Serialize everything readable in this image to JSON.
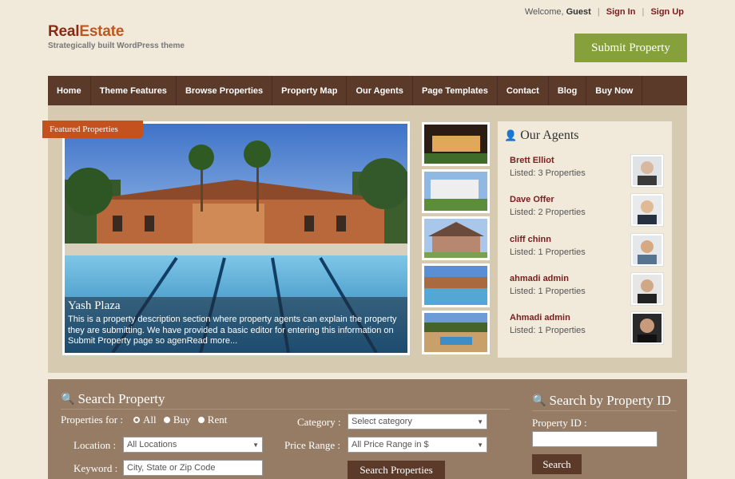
{
  "header": {
    "welcome_prefix": "Welcome,",
    "guest": "Guest",
    "sign_in": "Sign In",
    "sign_up": "Sign Up",
    "logo_part1": "Real",
    "logo_part2": "Estate",
    "tagline": "Strategically built WordPress theme",
    "submit_property": "Submit Property"
  },
  "nav": [
    "Home",
    "Theme Features",
    "Browse Properties",
    "Property Map",
    "Our Agents",
    "Page Templates",
    "Contact",
    "Blog",
    "Buy Now"
  ],
  "slider": {
    "badge": "Featured Properties",
    "title": "Yash Plaza",
    "description": "This is a property description section where property agents can explain the property they are submitting. We have provided a basic editor for entering this information on Submit Property page so agenRead more..."
  },
  "agents": {
    "title": "Our Agents",
    "list": [
      {
        "name": "Brett Elliot",
        "listed": "Listed: 3 Properties"
      },
      {
        "name": "Dave Offer",
        "listed": "Listed: 2 Properties"
      },
      {
        "name": "cliff chinn",
        "listed": "Listed: 1 Properties"
      },
      {
        "name": "ahmadi admin",
        "listed": "Listed: 1 Properties"
      },
      {
        "name": "Ahmadi admin",
        "listed": "Listed: 1 Properties"
      }
    ]
  },
  "search": {
    "title": "Search Property",
    "properties_for_label": "Properties for :",
    "options": [
      "All",
      "Buy",
      "Rent"
    ],
    "location_label": "Location :",
    "location_value": "All Locations",
    "keyword_label": "Keyword :",
    "keyword_placeholder": "City, State or Zip Code",
    "category_label": "Category :",
    "category_value": "Select category",
    "price_label": "Price Range :",
    "price_value": "All Price Range in $",
    "submit": "Search Properties"
  },
  "search_id": {
    "title": "Search by Property ID",
    "label": "Property ID :",
    "submit": "Search"
  },
  "colors": {
    "brand": "#8a2a10",
    "nav_bg": "#5b3a2a",
    "submit_bg": "#86a13c",
    "badge_bg": "#c4521e",
    "search_bg": "#967c65"
  }
}
